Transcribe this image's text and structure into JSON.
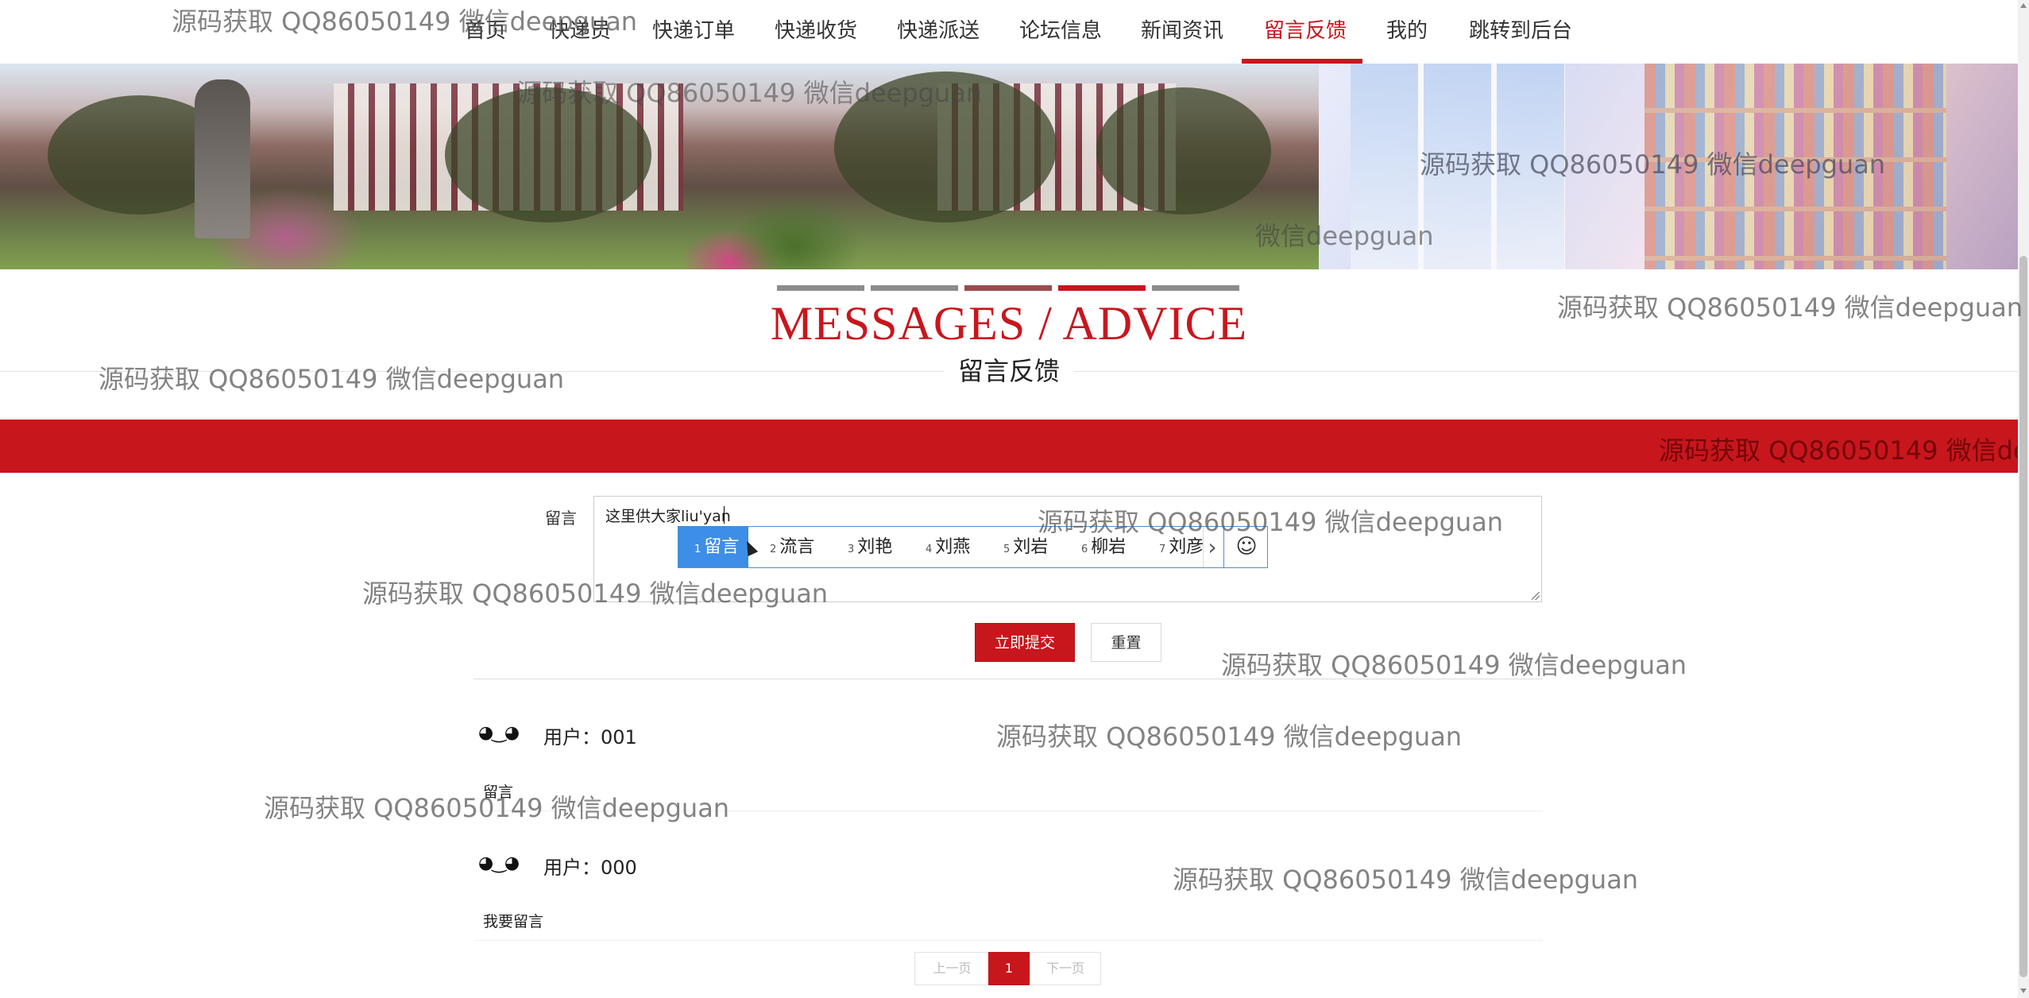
{
  "nav": {
    "items": [
      {
        "label": "首页"
      },
      {
        "label": "快递员"
      },
      {
        "label": "快递订单"
      },
      {
        "label": "快递收货"
      },
      {
        "label": "快递派送"
      },
      {
        "label": "论坛信息"
      },
      {
        "label": "新闻资讯"
      },
      {
        "label": "留言反馈",
        "active": true
      },
      {
        "label": "我的"
      },
      {
        "label": "跳转到后台"
      }
    ]
  },
  "colors": {
    "accent": "#c8161d",
    "bar_gray": "#8c8c8c"
  },
  "section": {
    "title_en": "MESSAGES / ADVICE",
    "title_cn": "留言反馈"
  },
  "form": {
    "label": "留言",
    "value": "这里供大家liu'yan",
    "submit_label": "立即提交",
    "reset_label": "重置"
  },
  "ime": {
    "candidates": [
      {
        "num": "1",
        "text": "留言",
        "selected": true
      },
      {
        "num": "2",
        "text": "流言"
      },
      {
        "num": "3",
        "text": "刘艳"
      },
      {
        "num": "4",
        "text": "刘燕"
      },
      {
        "num": "5",
        "text": "刘岩"
      },
      {
        "num": "6",
        "text": "柳岩"
      },
      {
        "num": "7",
        "text": "刘彦"
      }
    ],
    "next_icon": "chevron-right-icon",
    "emoji_icon": "smiley-icon"
  },
  "messages": [
    {
      "avatar": "◕‿◕",
      "user": "用户：001",
      "content": "留言"
    },
    {
      "avatar": "◕‿◕",
      "user": "用户：000",
      "content": "我要留言"
    }
  ],
  "pagination": {
    "prev": "上一页",
    "current": "1",
    "next": "下一页"
  },
  "watermark": "源码获取 QQ86050149 微信deepguan",
  "watermark_short": "微信deepguan"
}
